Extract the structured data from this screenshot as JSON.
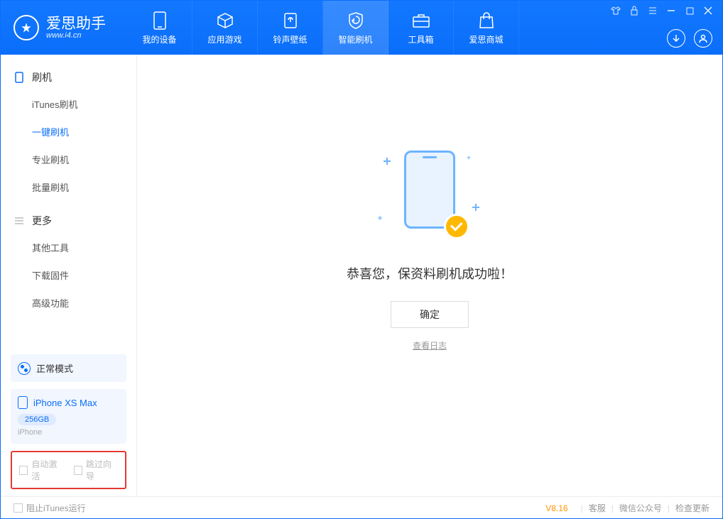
{
  "app": {
    "title": "爱思助手",
    "subtitle": "www.i4.cn"
  },
  "tabs": [
    {
      "label": "我的设备"
    },
    {
      "label": "应用游戏"
    },
    {
      "label": "铃声壁纸"
    },
    {
      "label": "智能刷机"
    },
    {
      "label": "工具箱"
    },
    {
      "label": "爱思商城"
    }
  ],
  "sidebar": {
    "sec1": {
      "title": "刷机",
      "items": [
        "iTunes刷机",
        "一键刷机",
        "专业刷机",
        "批量刷机"
      ]
    },
    "sec2": {
      "title": "更多",
      "items": [
        "其他工具",
        "下载固件",
        "高级功能"
      ]
    }
  },
  "device": {
    "mode": "正常模式",
    "name": "iPhone XS Max",
    "capacity": "256GB",
    "type": "iPhone"
  },
  "options": {
    "auto": "自动激活",
    "skip": "跳过向导"
  },
  "main": {
    "success": "恭喜您，保资料刷机成功啦！",
    "ok": "确定",
    "log": "查看日志"
  },
  "footer": {
    "block": "阻止iTunes运行",
    "version": "V8.16",
    "a": "客服",
    "b": "微信公众号",
    "c": "检查更新"
  }
}
